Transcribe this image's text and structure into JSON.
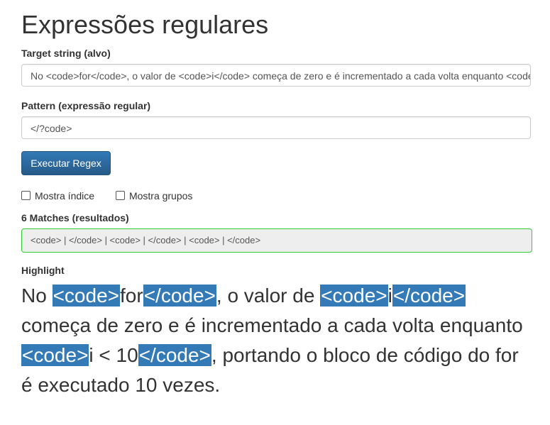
{
  "page": {
    "title": "Expressões regulares"
  },
  "target": {
    "label": "Target string (alvo)",
    "value": "No <code>for</code>, o valor de <code>i</code> começa de zero e é incrementado a cada volta enquanto <code>i < 10</code>, portando o bloco de código do for é executado 10 vezes."
  },
  "pattern": {
    "label": "Pattern (expressão regular)",
    "value": "</?code>"
  },
  "run_button": {
    "label": "Executar Regex"
  },
  "options": {
    "show_index": "Mostra índice",
    "show_groups": "Mostra grupos"
  },
  "results": {
    "label": "6 Matches (resultados)",
    "value": "<code> | </code> | <code> | </code> | <code> | </code>"
  },
  "highlight": {
    "label": "Highlight",
    "segments": [
      {
        "text": "No ",
        "match": false
      },
      {
        "text": "<code>",
        "match": true
      },
      {
        "text": "for",
        "match": false
      },
      {
        "text": "</code>",
        "match": true
      },
      {
        "text": ", o valor de ",
        "match": false
      },
      {
        "text": "<code>",
        "match": true
      },
      {
        "text": "i",
        "match": false
      },
      {
        "text": "</code>",
        "match": true
      },
      {
        "text": " começa de zero e é incrementado a cada volta enquanto ",
        "match": false
      },
      {
        "text": "<code>",
        "match": true
      },
      {
        "text": "i < 10",
        "match": false
      },
      {
        "text": "</code>",
        "match": true
      },
      {
        "text": ", portando o bloco de código do for é executado 10 vezes.",
        "match": false
      }
    ]
  },
  "colors": {
    "primary": "#337ab7",
    "success_border": "#33cc33",
    "highlight_bg": "#337ab7"
  }
}
